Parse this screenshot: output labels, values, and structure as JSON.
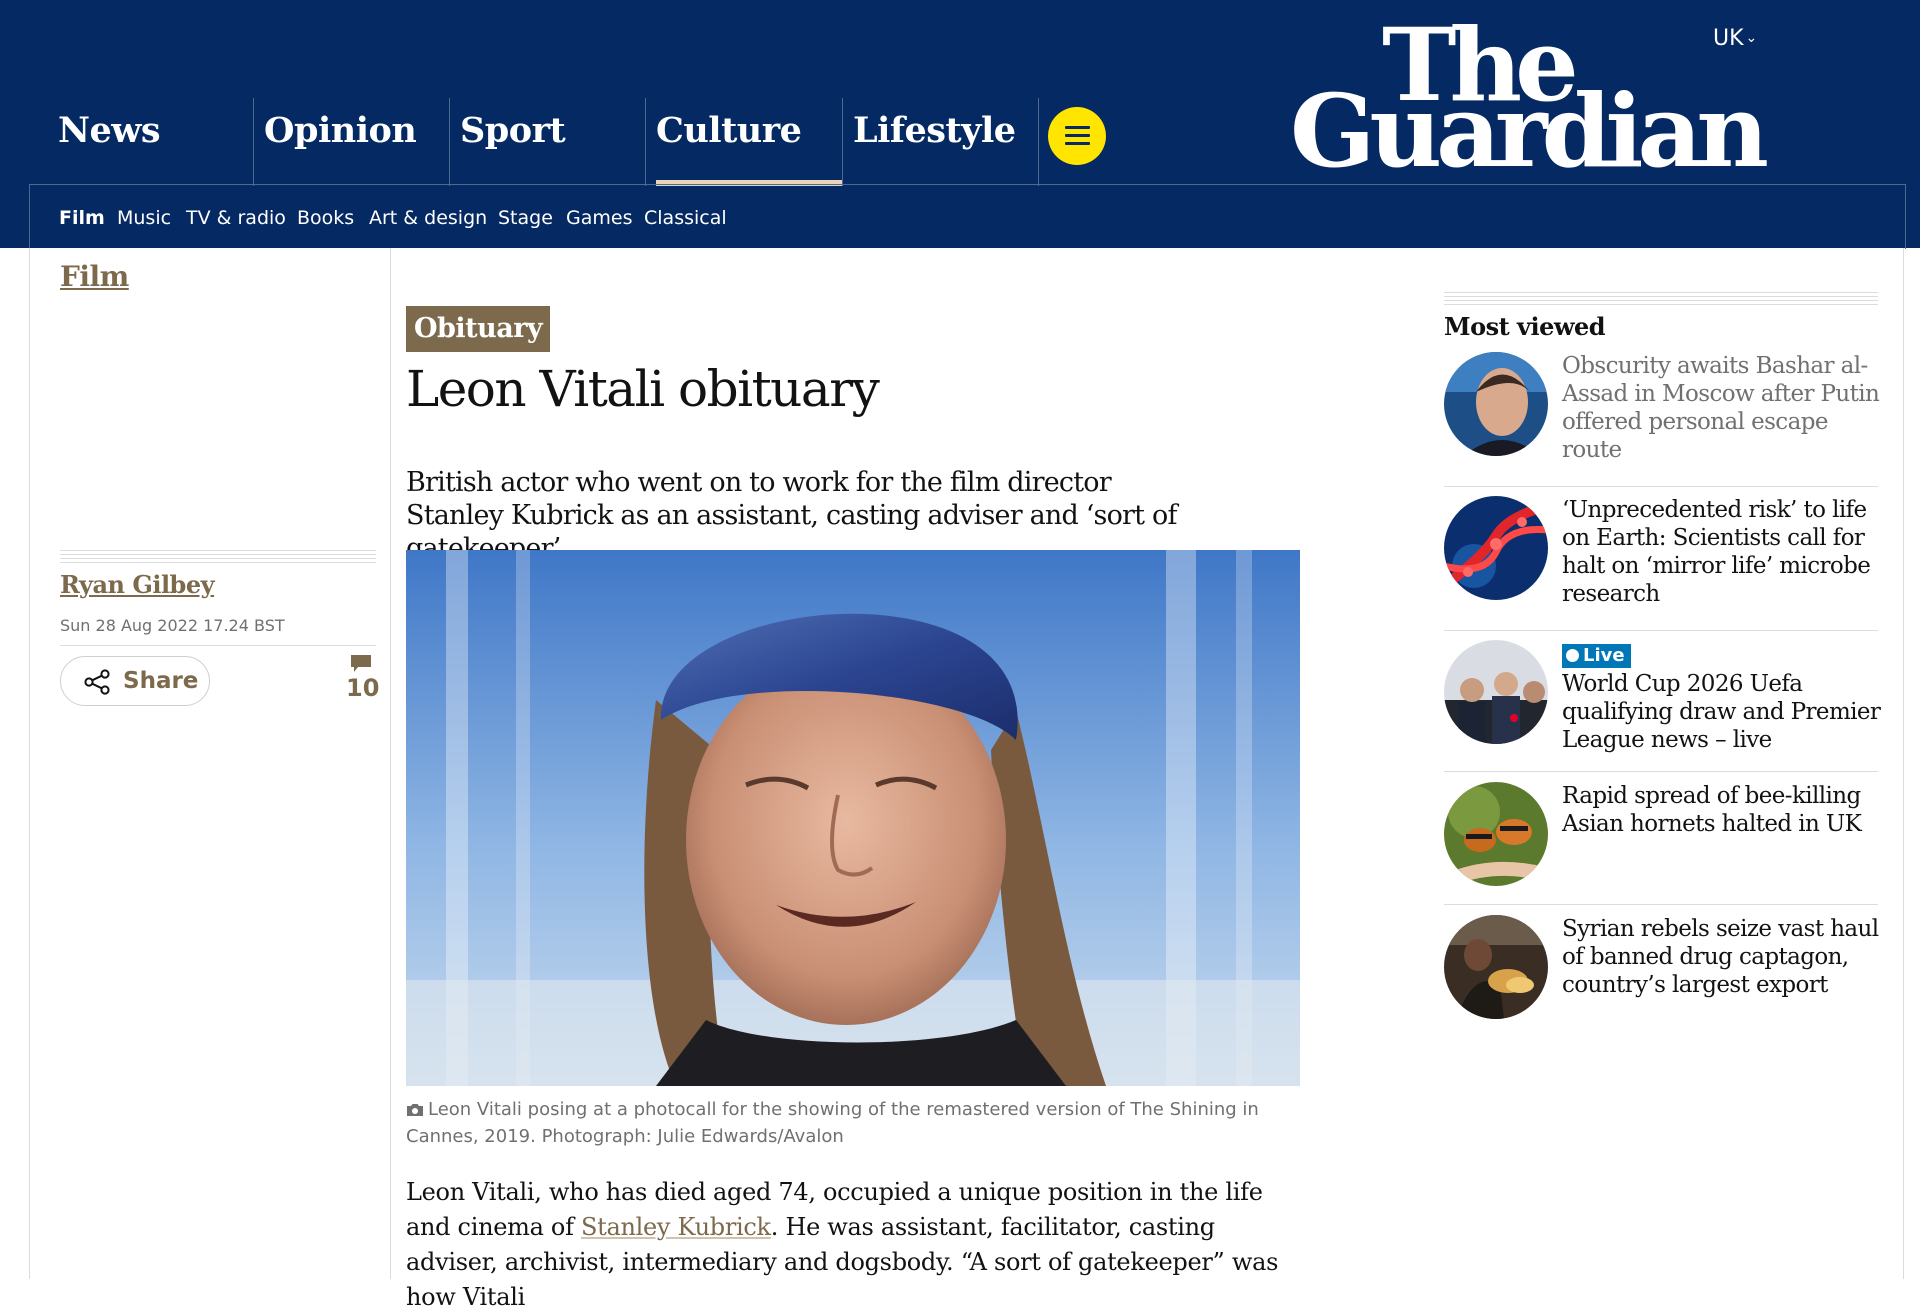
{
  "edition": {
    "label": "UK"
  },
  "logo": {
    "line1": "The",
    "line2": "Guardian"
  },
  "nav": {
    "pillars": [
      {
        "label": "News"
      },
      {
        "label": "Opinion"
      },
      {
        "label": "Sport"
      },
      {
        "label": "Culture",
        "active": true
      },
      {
        "label": "Lifestyle"
      }
    ],
    "subnav": [
      {
        "label": "Film",
        "active": true
      },
      {
        "label": "Music"
      },
      {
        "label": "TV & radio"
      },
      {
        "label": "Books"
      },
      {
        "label": "Art & design"
      },
      {
        "label": "Stage"
      },
      {
        "label": "Games"
      },
      {
        "label": "Classical"
      }
    ]
  },
  "article": {
    "section": "Film",
    "kicker": "Obituary",
    "headline": "Leon Vitali obituary",
    "standfirst": "British actor who went on to work for the film director Stanley Kubrick as an assistant, casting adviser and ‘sort of gatekeeper’",
    "author": "Ryan Gilbey",
    "date": "Sun 28 Aug 2022 17.24 BST",
    "share_label": "Share",
    "comment_count": "10",
    "caption": "Leon Vitali posing at a photocall for the showing of the remastered version of The Shining in Cannes, 2019. Photograph: Julie Edwards/Avalon",
    "body": {
      "before_link": "Leon Vitali, who has died aged 74, occupied a unique position in the life and cinema of ",
      "link_text": "Stanley Kubrick",
      "after_link": ". He was assistant, facilitator, casting adviser, archivist, intermediary and dogsbody. “A sort of gatekeeper” was how Vitali"
    }
  },
  "most_viewed": {
    "title": "Most viewed",
    "items": [
      {
        "headline": "Obscurity awaits Bashar al-Assad in Moscow after Putin offered personal escape route",
        "style": "muted"
      },
      {
        "headline": "‘Unprecedented risk’ to life on Earth: Scientists call for halt on ‘mirror life’ microbe research"
      },
      {
        "badge": "Live",
        "headline": "World Cup 2026 Uefa qualifying draw and Premier League news – live"
      },
      {
        "headline": "Rapid spread of bee-killing Asian hornets halted in UK"
      },
      {
        "headline": "Syrian rebels seize vast haul of banned drug captagon, country’s largest export"
      }
    ]
  },
  "colors": {
    "brand_blue": "#052962",
    "culture_accent": "#7d6a4c",
    "menu_yellow": "#ffe500",
    "live_blue": "#0077b6"
  },
  "icons": {
    "menu": "hamburger-icon",
    "share": "share-icon",
    "comments": "comment-icon",
    "camera": "camera-icon",
    "edition": "chevron-down-icon"
  }
}
